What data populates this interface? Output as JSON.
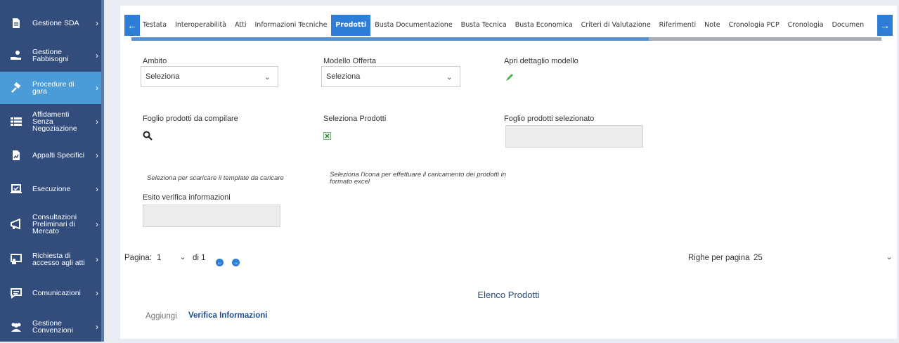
{
  "sidebar": {
    "items": [
      {
        "label": "Gestione SDA",
        "icon": "document-icon"
      },
      {
        "label": "Gestione Fabbisogni",
        "icon": "hand-icon"
      },
      {
        "label": "Procedure di gara",
        "icon": "gavel-icon"
      },
      {
        "label": "Affidamenti Senza Negoziazione",
        "icon": "list-icon"
      },
      {
        "label": "Appalti Specifici",
        "icon": "file-chart-icon"
      },
      {
        "label": "Esecuzione",
        "icon": "laptop-check-icon"
      },
      {
        "label": "Consultazioni Preliminari di Mercato",
        "icon": "megaphone-icon"
      },
      {
        "label": "Richiesta di accesso agli atti",
        "icon": "monitor-user-icon"
      },
      {
        "label": "Comunicazioni",
        "icon": "chat-icon"
      },
      {
        "label": "Gestione Convenzioni",
        "icon": "users-icon"
      }
    ],
    "chevron": "›"
  },
  "tabs": [
    "Testata",
    "Interoperabilità",
    "Atti",
    "Informazioni Tecniche",
    "Prodotti",
    "Busta Documentazione",
    "Busta Tecnica",
    "Busta Economica",
    "Criteri di Valutazione",
    "Riferimenti",
    "Note",
    "Cronologia PCP",
    "Cronologia",
    "Documen"
  ],
  "active_tab": "Prodotti",
  "tab_progress_fraction": 0.69,
  "form": {
    "ambito_label": "Ambito",
    "ambito_value": "Seleziona",
    "modello_label": "Modello Offerta",
    "modello_value": "Seleziona",
    "apri_label": "Apri dettaglio modello",
    "foglio_label": "Foglio prodotti da compilare",
    "seleziona_prodotti_label": "Seleziona Prodotti",
    "foglio_selezionato_label": "Foglio prodotti selezionato",
    "hint_template": "Seleziona per scaricare il template da caricare",
    "hint_icon": "Seleziona l'icona per effettuare il caricamento dei prodotti in formato excel",
    "esito_label": "Esito verifica informazioni"
  },
  "pagination": {
    "page_label": "Pagina:",
    "page_value": "1",
    "of_label": "di 1",
    "rows_label": "Righe per pagina",
    "rows_value": "25"
  },
  "list": {
    "title": "Elenco Prodotti",
    "add_label": "Aggiungi",
    "verify_label": "Verifica Informazioni"
  },
  "colors": {
    "sidebar": "#324d7c",
    "accent": "#2e7ed7",
    "active_sidebar": "#4a9bd7"
  }
}
